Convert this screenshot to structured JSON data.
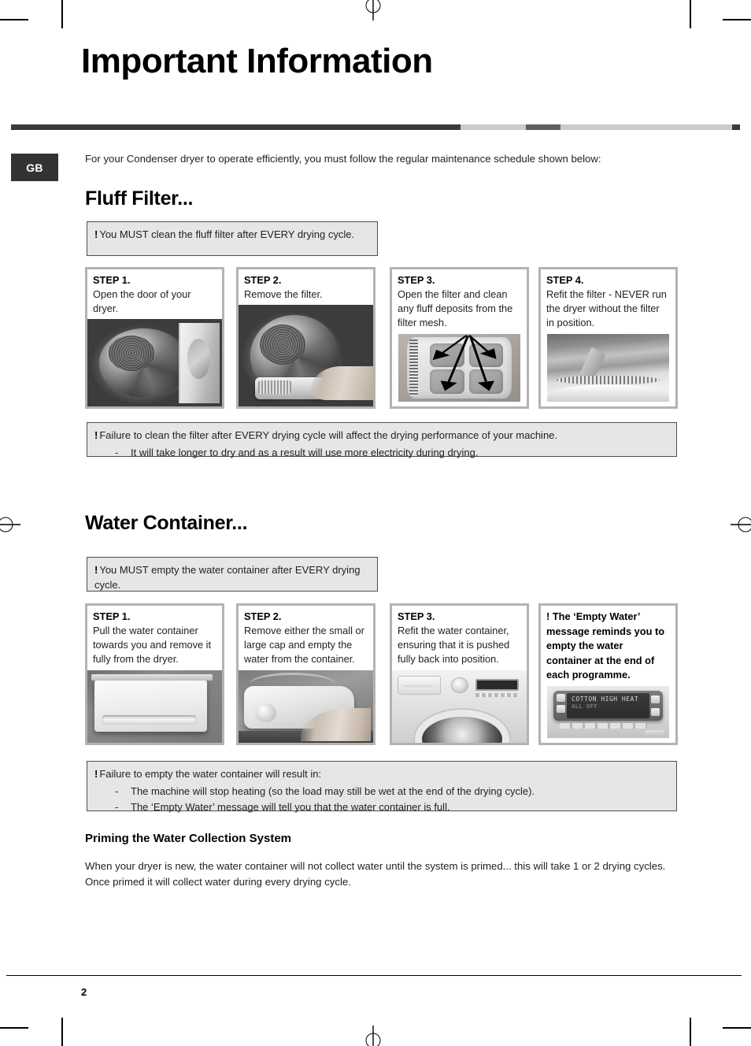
{
  "document": {
    "title": "Important Information",
    "language_badge": "GB",
    "intro": "For your Condenser dryer to operate efficiently, you must follow the regular maintenance schedule shown below:",
    "page_number": "2"
  },
  "header_rule": {
    "segments": [
      {
        "width_pct": 61.7,
        "color": "#3a3a3a"
      },
      {
        "width_pct": 8.9,
        "color": "#cbcbcb"
      },
      {
        "width_pct": 4.8,
        "color": "#5f5f5f"
      },
      {
        "width_pct": 23.5,
        "color": "#cbcbcb"
      },
      {
        "width_pct": 1.1,
        "color": "#3a3a3a"
      }
    ]
  },
  "sections": [
    {
      "id": "fluff-filter",
      "heading": "Fluff Filter...",
      "notice_top": {
        "bang": "!",
        "text": "You MUST clean the fluff filter after EVERY drying cycle."
      },
      "steps": [
        {
          "label": "STEP 1.",
          "text": "Open the door of your dryer.",
          "photo": "dryer-door-open-photo"
        },
        {
          "label": "STEP 2.",
          "text": "Remove the filter.",
          "photo": "removing-filter-photo"
        },
        {
          "label": "STEP 3.",
          "text": "Open the filter and clean any fluff deposits from the filter mesh.",
          "photo": "filter-mesh-arrows-photo"
        },
        {
          "label": "STEP 4.",
          "text": "Refit the filter - NEVER run the dryer without the filter in position.",
          "photo": "refitting-filter-photo"
        }
      ],
      "notice_bottom": {
        "bang": "!",
        "text": "Failure to clean the filter after EVERY drying cycle will affect the drying performance of your machine.",
        "bullets": [
          "It will take longer to dry and as a result will use more electricity during drying."
        ]
      }
    },
    {
      "id": "water-container",
      "heading": "Water Container...",
      "notice_top": {
        "bang": "!",
        "text": "You MUST empty the water container after EVERY drying cycle."
      },
      "steps": [
        {
          "label": "STEP 1.",
          "text": "Pull the water container towards you and remove it fully from the dryer.",
          "photo": "water-container-drawer-photo"
        },
        {
          "label": "STEP 2.",
          "text": "Remove either the small or large cap and empty the water from the container.",
          "photo": "emptying-container-photo"
        },
        {
          "label": "STEP 3.",
          "text": "Refit the water container, ensuring that it is pushed fully back into position.",
          "photo": "dryer-front-photo"
        }
      ],
      "callout": {
        "bang": "!",
        "text": "The ‘Empty Water’ message reminds you to empty the water container at the end of each programme.",
        "photo": "lcd-display-photo",
        "lcd_line_1": "COTTON HIGH HEAT",
        "lcd_line_2": "ALL  OFF"
      },
      "notice_bottom": {
        "bang": "!",
        "text": "Failure to empty the water container will result in:",
        "bullets": [
          "The machine will stop heating (so the load may still be wet at the end of the drying cycle).",
          "The ‘Empty Water’ message will tell you that the water container is full."
        ]
      },
      "subsection": {
        "heading": "Priming the Water Collection System",
        "body": "When your dryer is new, the water container will not collect water until the system is primed... this will take 1 or 2 drying cycles. Once primed it will collect water during every drying cycle."
      }
    }
  ]
}
